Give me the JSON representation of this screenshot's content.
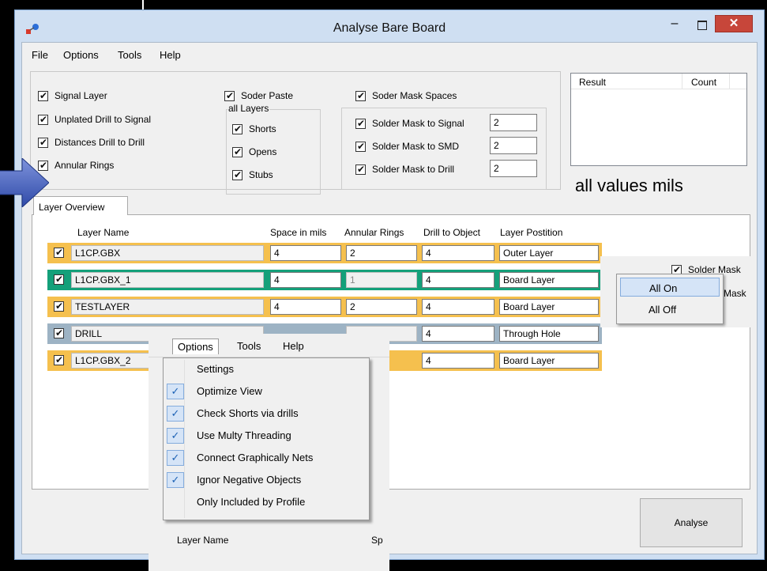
{
  "window": {
    "title": "Analyse Bare Board"
  },
  "menu": {
    "file": "File",
    "options": "Options",
    "tools": "Tools",
    "help": "Help"
  },
  "checks": {
    "signal_layer": "Signal Layer",
    "unplated_drill": "Unplated Drill to Signal",
    "distances_drill": "Distances Drill to Drill",
    "annular_rings": "Annular Rings",
    "soder_paste": "Soder Paste",
    "all_layers": "all Layers",
    "shorts": "Shorts",
    "opens": "Opens",
    "stubs": "Stubs",
    "soder_mask_spaces": "Soder Mask Spaces",
    "sm_signal": "Solder Mask to Signal",
    "sm_smd": "Solder Mask to SMD",
    "sm_drill": "Solder Mask to Drill",
    "sm_signal_value": "2",
    "sm_smd_value": "2",
    "sm_drill_value": "2"
  },
  "results": {
    "col_result": "Result",
    "col_count": "Count",
    "units_note": "all values mils"
  },
  "tab": {
    "label": "Layer Overview"
  },
  "columns": {
    "name": "Layer Name",
    "space": "Space in mils",
    "annular": "Annular Rings",
    "drill": "Drill to Object",
    "position": "Layer Postition"
  },
  "rows": [
    {
      "name": "L1CP.GBX",
      "space": "4",
      "annular": "2",
      "drill": "4",
      "position": "Outer Layer",
      "color": "#f5c04e"
    },
    {
      "name": "L1CP.GBX_1",
      "space": "4",
      "annular": "1",
      "drill": "4",
      "position": "Board Layer",
      "color": "#14a07a"
    },
    {
      "name": "TESTLAYER",
      "space": "4",
      "annular": "2",
      "drill": "4",
      "position": "Board Layer",
      "color": "#f5c04e"
    },
    {
      "name": "DRILL",
      "space": "",
      "annular": "",
      "drill": "4",
      "position": "Through Hole",
      "color": "#9db3c4"
    },
    {
      "name": "L1CP.GBX_2",
      "space": "",
      "annular": "",
      "drill": "4",
      "position": "Board Layer",
      "color": "#f5c04e"
    }
  ],
  "context_menu": {
    "all_on": "All On",
    "all_off": "All Off",
    "strip_label": "Solder Mask",
    "strip_label2": "Mask"
  },
  "options_menu": {
    "items": [
      {
        "label": "Settings",
        "checked": false
      },
      {
        "label": "Optimize View",
        "checked": true
      },
      {
        "label": "Check Shorts via drills",
        "checked": true
      },
      {
        "label": "Use Multy Threading",
        "checked": true
      },
      {
        "label": "Connect Graphically Nets",
        "checked": true
      },
      {
        "label": "Ignor Negative Objects",
        "checked": true
      },
      {
        "label": "Only Included by Profile",
        "checked": false
      }
    ],
    "ghost_layer_name": "Layer Name",
    "ghost_sp": "Sp"
  },
  "buttons": {
    "analyse": "Analyse"
  },
  "icons": {
    "app": "app-icon",
    "minimize": "minimize-icon",
    "maximize": "maximize-icon",
    "close": "close-icon",
    "arrow": "pointer-arrow-icon"
  }
}
